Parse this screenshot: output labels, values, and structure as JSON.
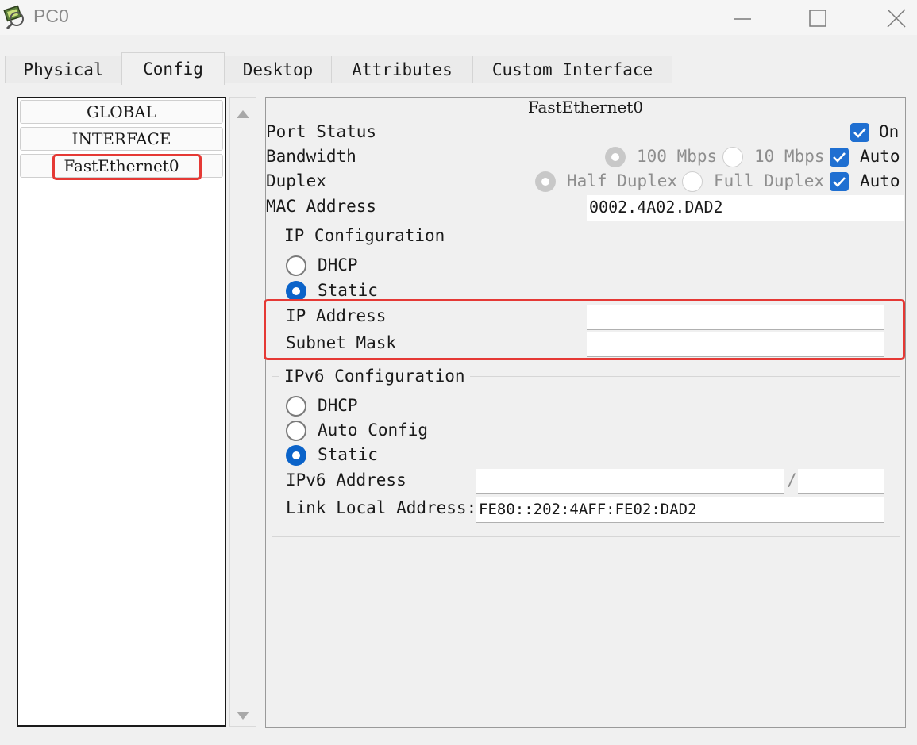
{
  "window": {
    "title": "PC0"
  },
  "tabs": [
    "Physical",
    "Config",
    "Desktop",
    "Attributes",
    "Custom Interface"
  ],
  "sidebar": {
    "items": [
      "GLOBAL",
      "INTERFACE",
      "FastEthernet0"
    ]
  },
  "panel": {
    "title": "FastEthernet0",
    "port_status": {
      "label": "Port Status",
      "checkbox": "On"
    },
    "bandwidth": {
      "label": "Bandwidth",
      "opt1": "100 Mbps",
      "opt2": "10 Mbps",
      "auto": "Auto"
    },
    "duplex": {
      "label": "Duplex",
      "opt1": "Half Duplex",
      "opt2": "Full Duplex",
      "auto": "Auto"
    },
    "mac": {
      "label": "MAC Address",
      "value": "0002.4A02.DAD2"
    },
    "ipv4": {
      "legend": "IP Configuration",
      "dhcp": "DHCP",
      "static": "Static",
      "ip_label": "IP Address",
      "ip_value": "",
      "mask_label": "Subnet Mask",
      "mask_value": ""
    },
    "ipv6": {
      "legend": "IPv6 Configuration",
      "dhcp": "DHCP",
      "auto": "Auto Config",
      "static": "Static",
      "addr_label": "IPv6 Address",
      "addr_value": "",
      "slash": "/",
      "prefix_value": "",
      "lla_label": "Link Local Address:",
      "lla_value": "FE80::202:4AFF:FE02:DAD2"
    }
  },
  "colors": {
    "accent": "#0b63c9",
    "highlight": "#e53935"
  }
}
